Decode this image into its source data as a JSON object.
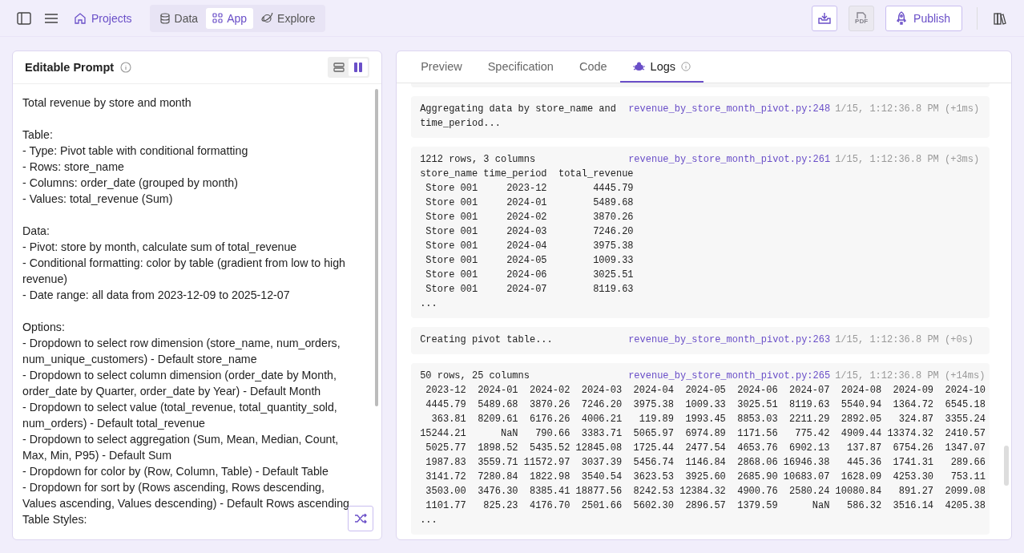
{
  "topbar": {
    "projects_link": "Projects",
    "nav_tabs": [
      {
        "label": "Data",
        "kind": "database",
        "selected": false
      },
      {
        "label": "App",
        "kind": "grid",
        "selected": true
      },
      {
        "label": "Explore",
        "kind": "planet",
        "selected": false
      }
    ],
    "pdf_button": {
      "label": "PDF",
      "disabled": true
    },
    "publish_button": "Publish"
  },
  "prompt_panel": {
    "title": "Editable Prompt",
    "view_modes": [
      {
        "kind": "rows",
        "selected": false
      },
      {
        "kind": "columns",
        "selected": true
      }
    ],
    "paragraphs": [
      [
        "Total revenue by store and month"
      ],
      [
        "Table:",
        "- Type: Pivot table with conditional formatting",
        "- Rows: store_name",
        "- Columns: order_date (grouped by month)",
        "- Values: total_revenue (Sum)"
      ],
      [
        "Data:",
        "- Pivot: store by month, calculate sum of total_revenue",
        "- Conditional formatting: color by table (gradient from low to high revenue)",
        "- Date range: all data from 2023-12-09 to 2025-12-07"
      ],
      [
        "Options:",
        "- Dropdown to select row dimension (store_name, num_orders, num_unique_customers) - Default store_name",
        "- Dropdown to select column dimension (order_date by Month, order_date by Quarter, order_date by Year) - Default Month",
        "- Dropdown to select value (total_revenue, total_quantity_sold, num_orders) - Default total_revenue",
        "- Dropdown to select aggregation (Sum, Mean, Median, Count, Max, Min, P95) - Default Sum",
        "- Dropdown for color by (Row, Column, Table) - Default Table",
        "- Dropdown for sort by (Rows ascending, Rows descending, Values ascending, Values descending) - Default Rows ascending",
        "Table Styles:"
      ]
    ]
  },
  "output_panel": {
    "tabs": [
      {
        "label": "Preview",
        "kind": "plain",
        "selected": false
      },
      {
        "label": "Specification",
        "kind": "plain",
        "selected": false
      },
      {
        "label": "Code",
        "kind": "plain",
        "selected": false
      },
      {
        "label": "Logs",
        "kind": "logs",
        "selected": true
      }
    ],
    "logs": [
      {
        "kind": "clipped"
      },
      {
        "kind": "message",
        "message": "Aggregating data by store_name and time_period...",
        "source": "revenue_by_store_month_pivot.py:248",
        "time": "1/15, 1:12:36.8 PM (+1ms)"
      },
      {
        "kind": "message",
        "message": "1212 rows, 3 columns",
        "source": "revenue_by_store_month_pivot.py:261",
        "time": "1/15, 1:12:36.8 PM (+3ms)",
        "output": [
          "store_name time_period  total_revenue",
          " Store 001     2023-12        4445.79",
          " Store 001     2024-01        5489.68",
          " Store 001     2024-02        3870.26",
          " Store 001     2024-03        7246.20",
          " Store 001     2024-04        3975.38",
          " Store 001     2024-05        1009.33",
          " Store 001     2024-06        3025.51",
          " Store 001     2024-07        8119.63",
          "..."
        ]
      },
      {
        "kind": "message",
        "message": "Creating pivot table...",
        "source": "revenue_by_store_month_pivot.py:263",
        "time": "1/15, 1:12:36.8 PM (+0s)"
      },
      {
        "kind": "message",
        "message": "50 rows, 25 columns",
        "source": "revenue_by_store_month_pivot.py:265",
        "time": "1/15, 1:12:36.8 PM (+14ms)",
        "output": [
          " 2023-12  2024-01  2024-02  2024-03  2024-04  2024-05  2024-06  2024-07  2024-08  2024-09  2024-10",
          " 4445.79  5489.68  3870.26  7246.20  3975.38  1009.33  3025.51  8119.63  5540.94  1364.72  6545.18",
          "  363.81  8209.61  6176.26  4006.21   119.89  1993.45  8853.03  2211.29  2892.05   324.87  3355.24",
          "15244.21      NaN   790.66  3383.71  5065.97  6974.89  1171.56   775.42  4909.44 13374.32  2410.57",
          " 5025.77  1898.52  5435.52 12845.08  1725.44  2477.54  4653.76  6902.13   137.87  6754.26  1347.07",
          " 1987.83  3559.71 11572.97  3037.39  5456.74  1146.84  2868.06 16946.38   445.36  1741.31   289.66",
          " 3141.72  7280.84  1822.98  3540.54  3623.53  3925.60  2685.90 10683.07  1628.09  4253.30   753.11",
          " 3503.00  3476.30  8385.41 18877.56  8242.53 12384.32  4900.76  2580.24 10080.84   891.27  2099.08",
          " 1101.77   825.23  4176.70  2501.66  5602.30  2896.57  1379.59      NaN   586.32  3516.14  4205.38",
          "..."
        ]
      }
    ]
  }
}
